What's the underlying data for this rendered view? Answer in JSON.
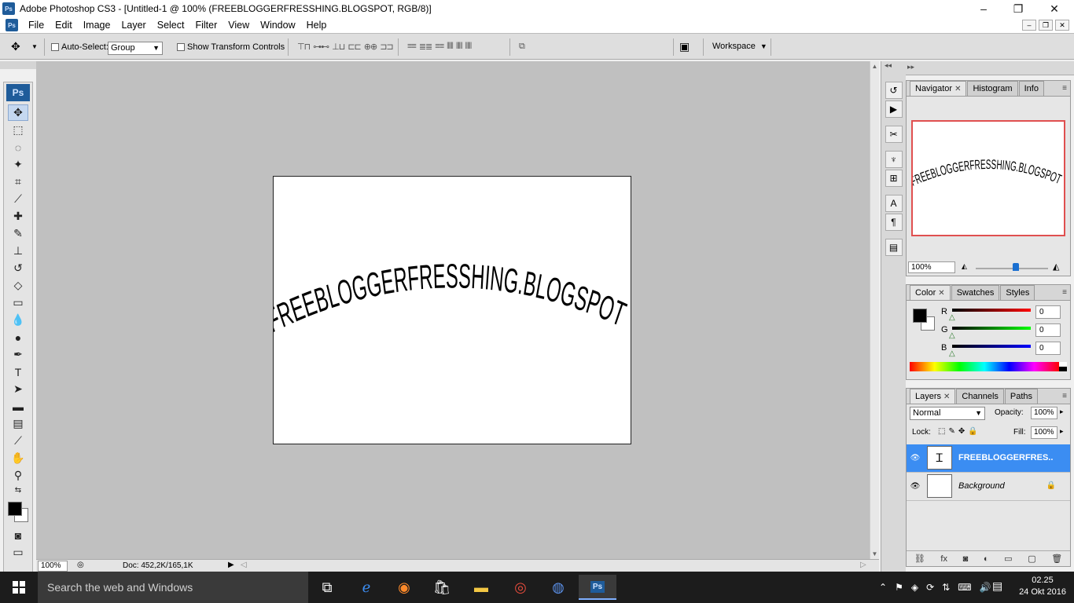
{
  "window": {
    "title": "Adobe Photoshop CS3 - [Untitled-1 @ 100% (FREEBLOGGERFRESSHING.BLOGSPOT, RGB/8)]",
    "minimize": "–",
    "maximize": "❐",
    "close": "✕"
  },
  "menu": {
    "items": [
      "File",
      "Edit",
      "Image",
      "Layer",
      "Select",
      "Filter",
      "View",
      "Window",
      "Help"
    ],
    "doc_minimize": "–",
    "doc_restore": "❐",
    "doc_close": "✕"
  },
  "options": {
    "auto_select_label": "Auto-Select:",
    "auto_select_value": "Group",
    "show_transform_label": "Show Transform Controls",
    "workspace_label": "Workspace"
  },
  "canvas": {
    "text": "FREEBLOGGERFRESSHING.BLOGSPOT"
  },
  "status": {
    "zoom": "100%",
    "doc": "Doc: 452,2K/165,1K"
  },
  "navigator": {
    "tabs": [
      "Navigator",
      "Histogram",
      "Info"
    ],
    "zoom": "100%",
    "thumb_text": "FREEBLOGGERFRESSHING.BLOGSPOT",
    "zoom_level": 0.55
  },
  "color": {
    "tabs": [
      "Color",
      "Swatches",
      "Styles"
    ],
    "r_label": "R",
    "g_label": "G",
    "b_label": "B",
    "r_value": "0",
    "g_value": "0",
    "b_value": "0",
    "foreground": "#000000",
    "background": "#ffffff"
  },
  "layers": {
    "tabs": [
      "Layers",
      "Channels",
      "Paths"
    ],
    "blend_mode": "Normal",
    "opacity_label": "Opacity:",
    "opacity_value": "100%",
    "lock_label": "Lock:",
    "fill_label": "Fill:",
    "fill_value": "100%",
    "items": [
      {
        "name": "FREEBLOGGERFRES...",
        "selected": true
      },
      {
        "name": "Background",
        "selected": false
      }
    ]
  },
  "taskbar": {
    "search_placeholder": "Search the web and Windows",
    "time": "02.25",
    "date": "24 Okt 2016"
  }
}
